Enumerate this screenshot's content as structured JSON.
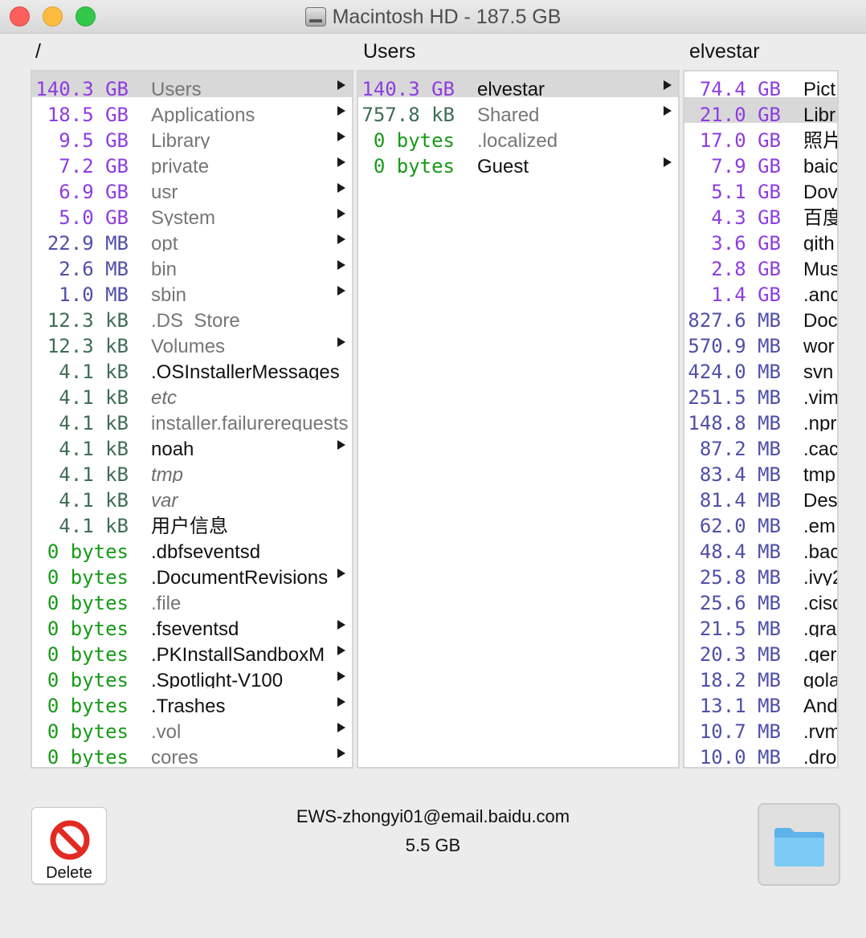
{
  "window": {
    "title": "Macintosh HD - 187.5 GB",
    "icon": "hard-drive-icon"
  },
  "columns": [
    {
      "title": "/",
      "rows": [
        {
          "size": "140.3 GB",
          "name": "Users",
          "size_color": "gb",
          "name_style": "gray",
          "arrow": true,
          "selected": true
        },
        {
          "size": "18.5 GB",
          "name": "Applications",
          "size_color": "gb",
          "name_style": "gray",
          "arrow": true
        },
        {
          "size": "9.5 GB",
          "name": "Library",
          "size_color": "gb",
          "name_style": "gray",
          "arrow": true
        },
        {
          "size": "7.2 GB",
          "name": "private",
          "size_color": "gb",
          "name_style": "gray",
          "arrow": true
        },
        {
          "size": "6.9 GB",
          "name": "usr",
          "size_color": "gb",
          "name_style": "gray",
          "arrow": true
        },
        {
          "size": "5.0 GB",
          "name": "System",
          "size_color": "gb",
          "name_style": "gray",
          "arrow": true
        },
        {
          "size": "22.9 MB",
          "name": "opt",
          "size_color": "mb",
          "name_style": "gray",
          "arrow": true
        },
        {
          "size": "2.6 MB",
          "name": "bin",
          "size_color": "mb",
          "name_style": "gray",
          "arrow": true
        },
        {
          "size": "1.0 MB",
          "name": "sbin",
          "size_color": "mb",
          "name_style": "gray",
          "arrow": true
        },
        {
          "size": "12.3 kB",
          "name": ".DS_Store",
          "size_color": "kb",
          "name_style": "gray",
          "arrow": false
        },
        {
          "size": "12.3 kB",
          "name": "Volumes",
          "size_color": "kb",
          "name_style": "gray",
          "arrow": true
        },
        {
          "size": "4.1 kB",
          "name": ".OSInstallerMessages",
          "size_color": "kb",
          "name_style": "black",
          "arrow": false
        },
        {
          "size": "4.1 kB",
          "name": "etc",
          "size_color": "kb",
          "name_style": "italic",
          "arrow": false
        },
        {
          "size": "4.1 kB",
          "name": "installer.failurerequests",
          "size_color": "kb",
          "name_style": "gray",
          "arrow": false
        },
        {
          "size": "4.1 kB",
          "name": "noah",
          "size_color": "kb",
          "name_style": "black",
          "arrow": true
        },
        {
          "size": "4.1 kB",
          "name": "tmp",
          "size_color": "kb",
          "name_style": "italic",
          "arrow": false
        },
        {
          "size": "4.1 kB",
          "name": "var",
          "size_color": "kb",
          "name_style": "italic",
          "arrow": false
        },
        {
          "size": "4.1 kB",
          "name": "用户信息",
          "size_color": "kb",
          "name_style": "black",
          "arrow": false
        },
        {
          "size": "0 bytes",
          "name": ".dbfseventsd",
          "size_color": "b",
          "name_style": "black",
          "arrow": false
        },
        {
          "size": "0 bytes",
          "name": ".DocumentRevisions",
          "size_color": "b",
          "name_style": "black",
          "arrow": true
        },
        {
          "size": "0 bytes",
          "name": ".file",
          "size_color": "b",
          "name_style": "gray",
          "arrow": false
        },
        {
          "size": "0 bytes",
          "name": ".fseventsd",
          "size_color": "b",
          "name_style": "black",
          "arrow": true
        },
        {
          "size": "0 bytes",
          "name": ".PKInstallSandboxM",
          "size_color": "b",
          "name_style": "black",
          "arrow": true
        },
        {
          "size": "0 bytes",
          "name": ".Spotlight-V100",
          "size_color": "b",
          "name_style": "black",
          "arrow": true
        },
        {
          "size": "0 bytes",
          "name": ".Trashes",
          "size_color": "b",
          "name_style": "black",
          "arrow": true
        },
        {
          "size": "0 bytes",
          "name": ".vol",
          "size_color": "b",
          "name_style": "gray",
          "arrow": true
        },
        {
          "size": "0 bytes",
          "name": "cores",
          "size_color": "b",
          "name_style": "gray",
          "arrow": true
        }
      ]
    },
    {
      "title": "Users",
      "rows": [
        {
          "size": "140.3 GB",
          "name": "elvestar",
          "size_color": "gb",
          "name_style": "black",
          "arrow": true,
          "selected": true
        },
        {
          "size": "757.8 kB",
          "name": "Shared",
          "size_color": "kb",
          "name_style": "gray",
          "arrow": true
        },
        {
          "size": "0 bytes",
          "name": ".localized",
          "size_color": "b",
          "name_style": "gray",
          "arrow": false
        },
        {
          "size": "0 bytes",
          "name": "Guest",
          "size_color": "b",
          "name_style": "black",
          "arrow": true
        }
      ]
    },
    {
      "title": "elvestar",
      "rows": [
        {
          "size": "74.4 GB",
          "name": "Pict",
          "size_color": "gb",
          "name_style": "black"
        },
        {
          "size": "21.0 GB",
          "name": "Libr",
          "size_color": "gb",
          "name_style": "black",
          "selected": true
        },
        {
          "size": "17.0 GB",
          "name": "照片",
          "size_color": "gb",
          "name_style": "black"
        },
        {
          "size": "7.9 GB",
          "name": "baic",
          "size_color": "gb",
          "name_style": "black"
        },
        {
          "size": "5.1 GB",
          "name": "Dov",
          "size_color": "gb",
          "name_style": "black"
        },
        {
          "size": "4.3 GB",
          "name": "百度",
          "size_color": "gb",
          "name_style": "black"
        },
        {
          "size": "3.6 GB",
          "name": "gith",
          "size_color": "gb",
          "name_style": "black"
        },
        {
          "size": "2.8 GB",
          "name": "Mus",
          "size_color": "gb",
          "name_style": "black"
        },
        {
          "size": "1.4 GB",
          "name": ".anc",
          "size_color": "gb",
          "name_style": "black"
        },
        {
          "size": "827.6 MB",
          "name": "Doc",
          "size_color": "mb",
          "name_style": "black"
        },
        {
          "size": "570.9 MB",
          "name": "wor",
          "size_color": "mb",
          "name_style": "black"
        },
        {
          "size": "424.0 MB",
          "name": "svn",
          "size_color": "mb",
          "name_style": "black"
        },
        {
          "size": "251.5 MB",
          "name": ".vim",
          "size_color": "mb",
          "name_style": "black"
        },
        {
          "size": "148.8 MB",
          "name": ".npr",
          "size_color": "mb",
          "name_style": "black"
        },
        {
          "size": "87.2 MB",
          "name": ".cac",
          "size_color": "mb",
          "name_style": "black"
        },
        {
          "size": "83.4 MB",
          "name": "tmp",
          "size_color": "mb",
          "name_style": "black"
        },
        {
          "size": "81.4 MB",
          "name": "Des",
          "size_color": "mb",
          "name_style": "black"
        },
        {
          "size": "62.0 MB",
          "name": ".em",
          "size_color": "mb",
          "name_style": "black"
        },
        {
          "size": "48.4 MB",
          "name": ".bac",
          "size_color": "mb",
          "name_style": "black"
        },
        {
          "size": "25.8 MB",
          "name": ".ivy2",
          "size_color": "mb",
          "name_style": "black"
        },
        {
          "size": "25.6 MB",
          "name": ".cisc",
          "size_color": "mb",
          "name_style": "black"
        },
        {
          "size": "21.5 MB",
          "name": ".gra",
          "size_color": "mb",
          "name_style": "black"
        },
        {
          "size": "20.3 MB",
          "name": ".ger",
          "size_color": "mb",
          "name_style": "black"
        },
        {
          "size": "18.2 MB",
          "name": "gola",
          "size_color": "mb",
          "name_style": "black"
        },
        {
          "size": "13.1 MB",
          "name": "And",
          "size_color": "mb",
          "name_style": "black"
        },
        {
          "size": "10.7 MB",
          "name": ".rvm",
          "size_color": "mb",
          "name_style": "black"
        },
        {
          "size": "10.0 MB",
          "name": ".dro",
          "size_color": "mb",
          "name_style": "black"
        }
      ]
    }
  ],
  "footer": {
    "email": "EWS-zhongyi01@email.baidu.com",
    "size": "5.5 GB",
    "delete_label": "Delete",
    "delete_icon": "no-entry-icon",
    "folder_icon": "folder-icon"
  },
  "colors": {
    "gb": "#8e3ce0",
    "mb": "#4f4fa8",
    "kb": "#3f6d55",
    "bytes": "#179a18",
    "selection": "#d8d8d8"
  }
}
